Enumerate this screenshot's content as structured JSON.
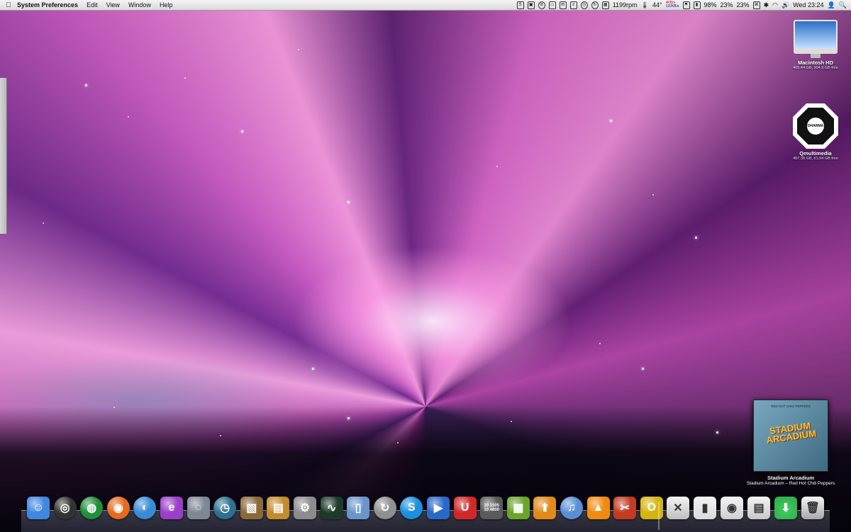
{
  "menubar": {
    "apple_icon": "apple-icon",
    "app_name": "System Preferences",
    "menus": [
      "Edit",
      "View",
      "Window",
      "Help"
    ],
    "status": {
      "fan_speed": "1199rpm",
      "temperature": "44°",
      "net_up": "4KB/s",
      "net_down": "122KB/s",
      "battery": "98%",
      "cpu1": "23%",
      "cpu2": "23%",
      "clock": "Wed 23:24"
    }
  },
  "desktop": {
    "icons": [
      {
        "name": "Macintosh HD",
        "info": "465.44 GB, 304.9 GB free",
        "icon": "hard-drive-icon"
      },
      {
        "name": "Qmultimedia",
        "info": "457.38 GB, 61.94 GB free",
        "icon": "dharma-drive-icon",
        "logo_text": "DHARMA"
      }
    ]
  },
  "now_playing": {
    "cover_band": "RED HOT CHILI PEPPERS",
    "cover_title": "STADIUM ARCADIUM",
    "album": "Stadium Arcadium",
    "detail": "Stadium Arcadium – Red Hot Chili Peppers"
  },
  "dock": {
    "apps": [
      {
        "name": "finder",
        "color": "#3f87e0"
      },
      {
        "name": "dashboard",
        "color": "#333333"
      },
      {
        "name": "colorsync",
        "color": "#1f8f3a"
      },
      {
        "name": "firefox",
        "color": "#e56a1c"
      },
      {
        "name": "network-utility",
        "color": "#3a8bd6"
      },
      {
        "name": "messenger",
        "color": "#9a3fc8"
      },
      {
        "name": "address-bar",
        "color": "#7d8796"
      },
      {
        "name": "time-machine",
        "color": "#2c6f8f"
      },
      {
        "name": "iphoto",
        "color": "#8a6a3a"
      },
      {
        "name": "preview",
        "color": "#c28b2c"
      },
      {
        "name": "system-preferences",
        "color": "#8c8c8c"
      },
      {
        "name": "activity-monitor",
        "color": "#1c3a2a"
      },
      {
        "name": "disk-utility",
        "color": "#6a95c9"
      },
      {
        "name": "sync",
        "color": "#8f8f8f"
      },
      {
        "name": "skype",
        "color": "#1a8fdc"
      },
      {
        "name": "ichat",
        "color": "#2a68c8"
      },
      {
        "name": "magnet",
        "color": "#d02828"
      },
      {
        "name": "torrent-counter",
        "color": "#5a5a5a",
        "counter_top": "10 1505",
        "counter_bottom": "10 4800"
      },
      {
        "name": "grid-app",
        "color": "#6aa42a"
      },
      {
        "name": "transmit",
        "color": "#e08a1a"
      },
      {
        "name": "itunes",
        "color": "#5a8fd6"
      },
      {
        "name": "vlc",
        "color": "#f08a10"
      },
      {
        "name": "cleaner",
        "color": "#c23b22"
      },
      {
        "name": "office",
        "color": "#d4b410"
      }
    ],
    "stacks": [
      {
        "name": "applications-stack",
        "color": "#bfbfbf"
      },
      {
        "name": "documents-stack",
        "color": "#dadada"
      },
      {
        "name": "pictures-stack",
        "color": "#cfcfcf"
      },
      {
        "name": "movies-stack",
        "color": "#c8c8c8"
      },
      {
        "name": "downloads-stack",
        "color": "#2fa64a"
      },
      {
        "name": "trash",
        "color": "#a8a8a8"
      }
    ]
  }
}
